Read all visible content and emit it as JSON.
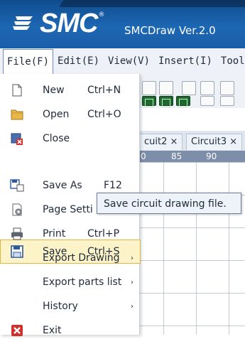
{
  "header": {
    "logo_text": "SMC",
    "logo_registered": "®",
    "app_title": "SMCDraw Ver.2.0"
  },
  "menubar": {
    "items": [
      {
        "label": "File(F)",
        "active": true
      },
      {
        "label": "Edit(E)"
      },
      {
        "label": "View(V)"
      },
      {
        "label": "Insert(I)"
      },
      {
        "label": "Tools"
      }
    ]
  },
  "tabs": [
    {
      "label": "cuit2",
      "close": "×"
    },
    {
      "label": "Circuit3",
      "close": "×"
    }
  ],
  "ruler": {
    "labels": [
      "0",
      "85",
      "90"
    ]
  },
  "file_menu": {
    "items": [
      {
        "label": "New",
        "shortcut": "Ctrl+N",
        "icon": "new-document-icon"
      },
      {
        "label": "Open",
        "shortcut": "Ctrl+O",
        "icon": "folder-icon"
      },
      {
        "label": "Close",
        "shortcut": "",
        "icon": "close-document-icon"
      },
      {
        "label": "Save",
        "shortcut": "Ctrl+S",
        "icon": "save-icon",
        "highlighted": true
      },
      {
        "label": "Save As",
        "shortcut": "F12",
        "icon": "save-as-icon"
      },
      {
        "label": "Page Setti",
        "shortcut": "",
        "icon": "page-settings-icon"
      },
      {
        "label": "Print",
        "shortcut": "Ctrl+P",
        "icon": "printer-icon"
      },
      {
        "label": "Export Drawing",
        "submenu": "›"
      },
      {
        "label": "Export parts list",
        "submenu": "›"
      },
      {
        "label": "History",
        "submenu": "›"
      },
      {
        "label": "Exit",
        "shortcut": "",
        "icon": "exit-icon"
      }
    ]
  },
  "tooltip": {
    "text": "Save circuit drawing file."
  },
  "colors": {
    "header_blue": "#1d67b3",
    "highlight_bg": "#fdf3c8",
    "highlight_border": "#e2b53f",
    "exit_red": "#d0302b"
  }
}
